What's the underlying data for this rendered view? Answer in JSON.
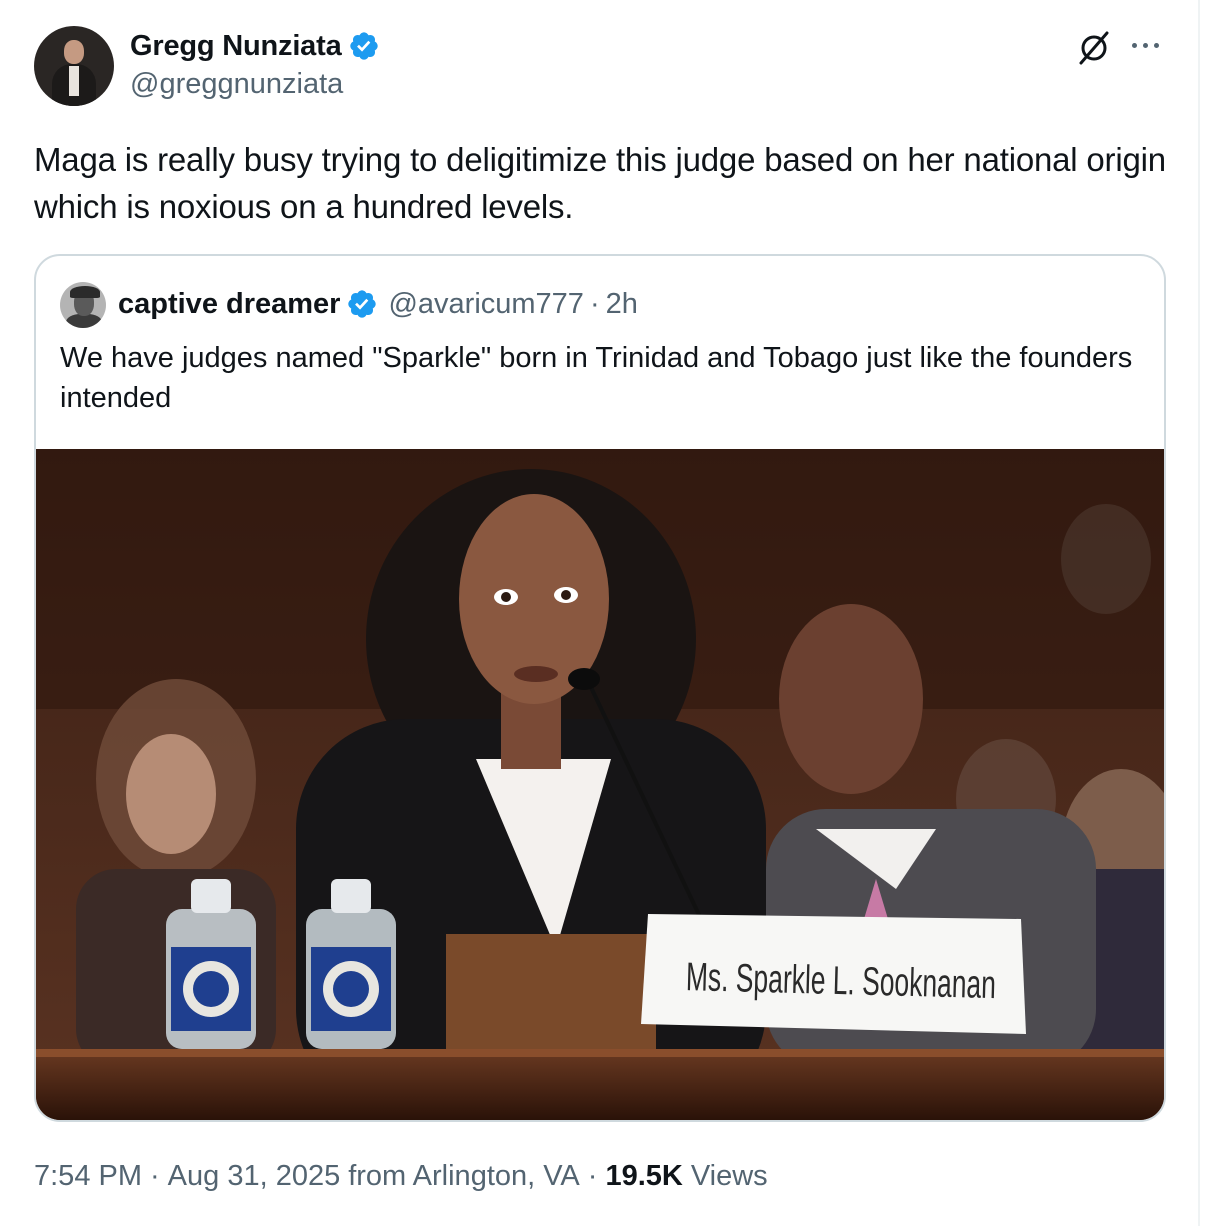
{
  "tweet": {
    "author": {
      "display_name": "Gregg Nunziata",
      "handle": "@greggnunziata",
      "verified": true,
      "verified_color": "#1d9bf0"
    },
    "text": "Maga is really busy trying to deligitimize this judge based on her national origin which is noxious on a hundred levels.",
    "icons": {
      "grok": "grok-icon",
      "more": "more-icon"
    },
    "meta": {
      "time": "7:54 PM",
      "date": "Aug 31, 2025",
      "location": "from Arlington, VA",
      "views_count": "19.5K",
      "views_label": "Views",
      "separator": "·"
    }
  },
  "quote": {
    "author": {
      "display_name": "captive dreamer",
      "handle": "@avaricum777",
      "separator": "·",
      "time": "2h",
      "verified": true
    },
    "text": "We have judges named \"Sparkle\" born in Trinidad and Tobago just like the founders intended",
    "image": {
      "nameplate_text": "Ms. Sparkle L. Sooknanan"
    }
  },
  "colors": {
    "text": "#0f1419",
    "secondary": "#536471",
    "border": "#cfd9de",
    "verified": "#1d9bf0"
  }
}
